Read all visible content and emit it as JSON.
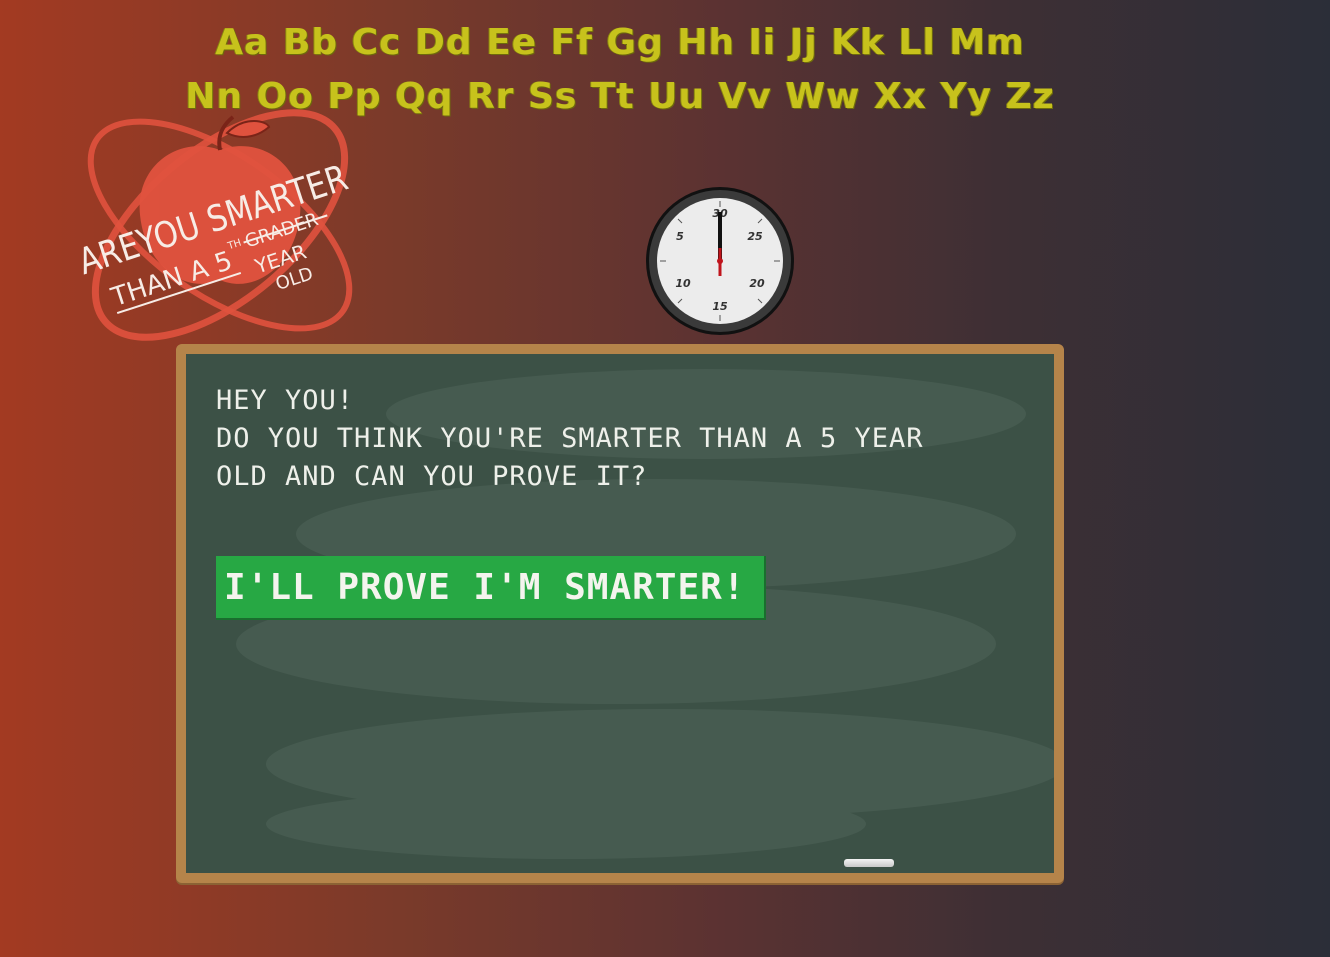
{
  "alphabet": {
    "row1": "Aa Bb Cc Dd Ee Ff Gg Hh Ii Jj Kk Ll Mm",
    "row2": "Nn Oo Pp Qq Rr Ss Tt Uu Vv Ww Xx Yy Zz",
    "color": "#c7c21c"
  },
  "logo": {
    "line1": "AREYOU SMARTER",
    "line2": "THAN A 5",
    "sup": "TH",
    "struck": "GRADER",
    "handwritten1": "YEAR",
    "handwritten2": "OLD",
    "color": "#e0523e"
  },
  "clock": {
    "labels": [
      "30",
      "5",
      "25",
      "10",
      "20",
      "15"
    ],
    "hand_color": "#c0141c"
  },
  "board": {
    "line1": "Hey you!",
    "line2": "Do you think you're smarter than a 5 year",
    "line3": "old and can you prove it?",
    "button_label": "I'll prove I'm smarter!",
    "button_color": "#27a844",
    "frame_color": "#b5844a"
  }
}
